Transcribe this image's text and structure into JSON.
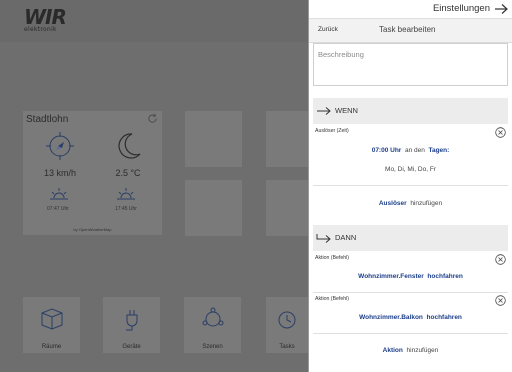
{
  "background": {
    "logo_main": "WIR",
    "logo_sub": "elektronik",
    "weather": {
      "city": "Stadtlohn",
      "wind": "13 km/h",
      "temperature": "2.5 °C",
      "sunrise": "07:47 Uhr",
      "sunset": "17:45 Uhr",
      "credit": "by OpenWeatherMap"
    },
    "tiles": [
      {
        "label": "Räume",
        "icon": "cube-icon"
      },
      {
        "label": "Geräte",
        "icon": "plug-icon"
      },
      {
        "label": "Szenen",
        "icon": "scene-icon"
      },
      {
        "label": "Tasks",
        "icon": "task-icon"
      }
    ]
  },
  "panel": {
    "top_title": "Einstellungen",
    "task_bar": {
      "back": "Zurück",
      "title": "Task bearbeiten"
    },
    "description_placeholder": "Beschreibung",
    "wenn": {
      "label": "WENN",
      "trigger": {
        "caption": "Auslöser (Zeit)",
        "time": "07:00 Uhr",
        "connector": "an den",
        "days_link": "Tagen:",
        "days": "Mo, Di, Mi, Do, Fr"
      },
      "add_link": "Auslöser",
      "add_text": "hinzufügen"
    },
    "dann": {
      "label": "DANN",
      "actions": [
        {
          "caption": "Aktion (Befehl)",
          "target": "Wohnzimmer.Fenster",
          "command": "hochfahren"
        },
        {
          "caption": "Aktion (Befehl)",
          "target": "Wohnzimmer.Balkon",
          "command": "hochfahren"
        }
      ],
      "add_link": "Aktion",
      "add_text": "hinzufügen"
    }
  },
  "colors": {
    "accent_blue": "#1a3d8a",
    "overlay": "#6e6e6e"
  }
}
